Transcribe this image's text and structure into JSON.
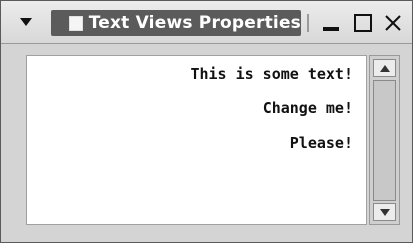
{
  "window": {
    "title": "Text Views Properties",
    "icons": {
      "menu": "triangle-down-icon",
      "window": "window-icon",
      "minimize": "minimize-icon",
      "maximize": "maximize-icon",
      "close": "close-icon"
    }
  },
  "content": {
    "lines": [
      "This is some text!",
      "Change me!",
      "Please!"
    ]
  },
  "scrollbar": {
    "up": "arrow-up-icon",
    "down": "arrow-down-icon"
  }
}
